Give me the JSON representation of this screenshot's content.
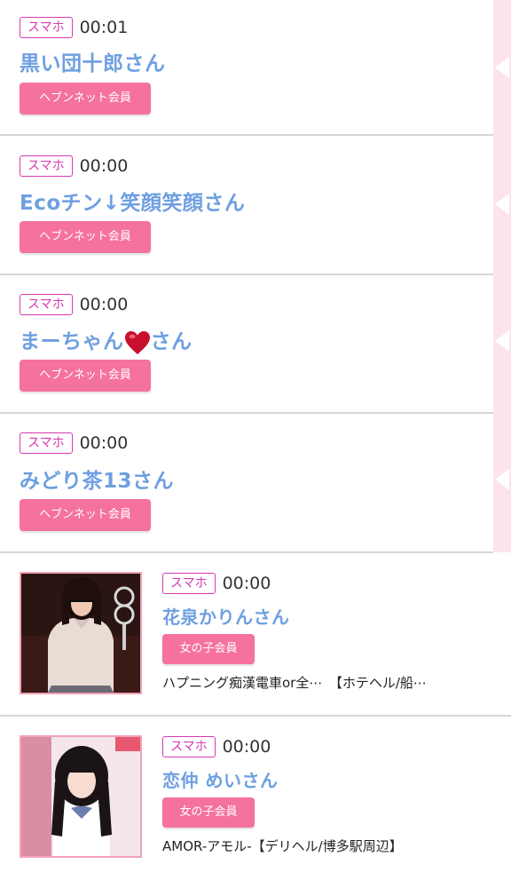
{
  "entries": [
    {
      "device": "スマホ",
      "time": "00:01",
      "name": "黒い団十郎さん",
      "member": "ヘブンネット会員"
    },
    {
      "device": "スマホ",
      "time": "00:00",
      "name": "Ecoチン↓笑顔笑顔さん",
      "member": "ヘブンネット会員"
    },
    {
      "device": "スマホ",
      "time": "00:00",
      "name_before": "まーちゃん",
      "name_after": "さん",
      "member": "ヘブンネット会員"
    },
    {
      "device": "スマホ",
      "time": "00:00",
      "name": "みどり茶13さん",
      "member": "ヘブンネット会員"
    },
    {
      "device": "スマホ",
      "time": "00:00",
      "name": "花泉かりんさん",
      "member": "女の子会員",
      "shop": "ハプニング痴漢電車or全⋯　【ホテヘル/船⋯"
    },
    {
      "device": "スマホ",
      "time": "00:00",
      "name": "恋仲 めいさん",
      "member": "女の子会員",
      "shop": "AMOR-アモル-【デリヘル/博多駅周辺】"
    }
  ],
  "colors": {
    "badge": "#d63ab0",
    "name": "#6e9fe1",
    "member_button": "#f5729e",
    "strip": "#fde4ea"
  }
}
